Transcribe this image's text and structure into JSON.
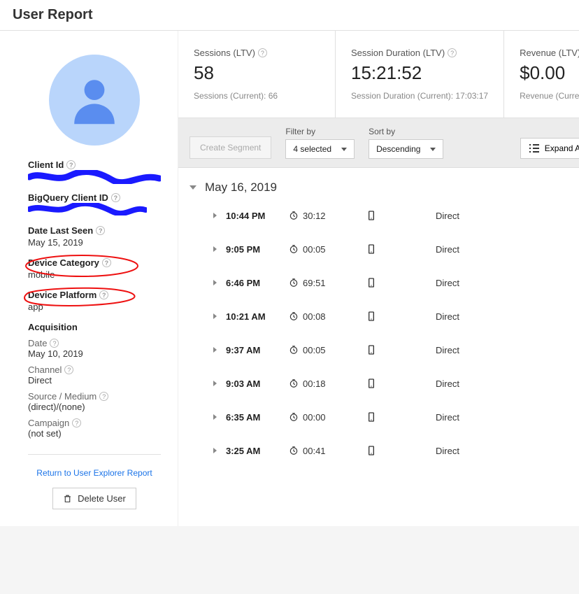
{
  "page_title": "User Report",
  "sidebar": {
    "client_id_label": "Client Id",
    "bigquery_label": "BigQuery Client ID",
    "date_last_seen_label": "Date Last Seen",
    "date_last_seen_value": "May 15, 2019",
    "device_category_label": "Device Category",
    "device_category_value": "mobile",
    "device_platform_label": "Device Platform",
    "device_platform_value": "app",
    "acquisition_label": "Acquisition",
    "acq_date_label": "Date",
    "acq_date_value": "May 10, 2019",
    "acq_channel_label": "Channel",
    "acq_channel_value": "Direct",
    "acq_source_label": "Source / Medium",
    "acq_source_value": "(direct)/(none)",
    "acq_campaign_label": "Campaign",
    "acq_campaign_value": "(not set)",
    "return_link": "Return to User Explorer Report",
    "delete_button": "Delete User"
  },
  "kpis": {
    "sessions_label": "Sessions (LTV)",
    "sessions_value": "58",
    "sessions_sub": "Sessions (Current): 66",
    "duration_label": "Session Duration (LTV)",
    "duration_value": "15:21:52",
    "duration_sub": "Session Duration (Current): 17:03:17",
    "revenue_label": "Revenue (LTV)",
    "revenue_value": "$0.00",
    "revenue_sub": "Revenue (Current)"
  },
  "controls": {
    "create_segment": "Create Segment",
    "filter_label": "Filter by",
    "filter_value": "4 selected",
    "sort_label": "Sort by",
    "sort_value": "Descending",
    "expand_all": "Expand All"
  },
  "day": {
    "date": "May 16, 2019",
    "sessions": [
      {
        "time": "10:44 PM",
        "duration": "30:12",
        "channel": "Direct"
      },
      {
        "time": "9:05 PM",
        "duration": "00:05",
        "channel": "Direct"
      },
      {
        "time": "6:46 PM",
        "duration": "69:51",
        "channel": "Direct"
      },
      {
        "time": "10:21 AM",
        "duration": "00:08",
        "channel": "Direct"
      },
      {
        "time": "9:37 AM",
        "duration": "00:05",
        "channel": "Direct"
      },
      {
        "time": "9:03 AM",
        "duration": "00:18",
        "channel": "Direct"
      },
      {
        "time": "6:35 AM",
        "duration": "00:00",
        "channel": "Direct"
      },
      {
        "time": "3:25 AM",
        "duration": "00:41",
        "channel": "Direct"
      }
    ]
  }
}
